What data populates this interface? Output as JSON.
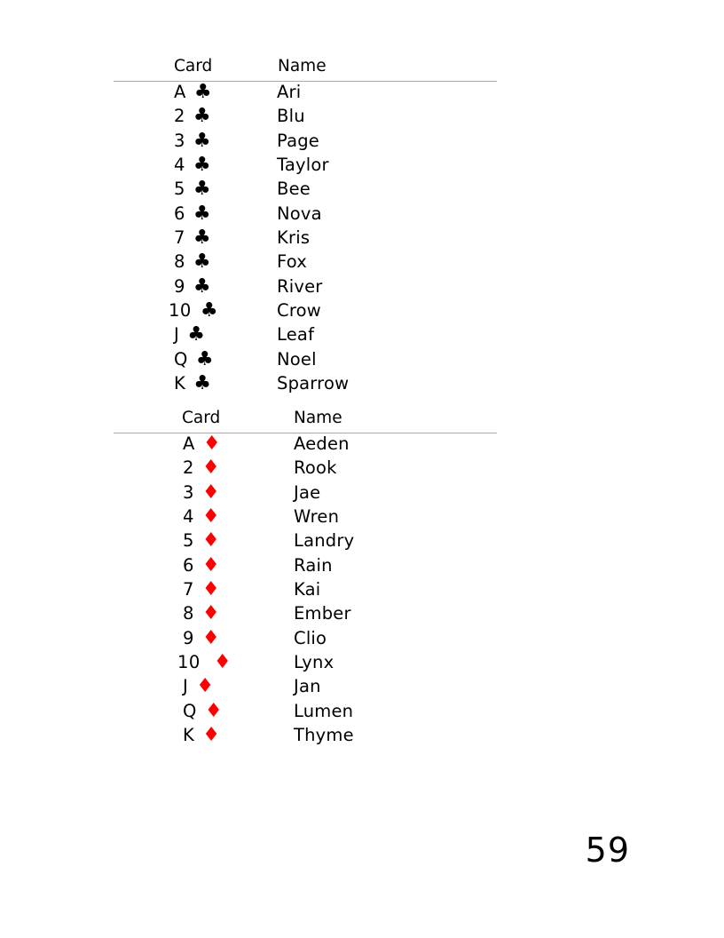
{
  "clubs": {
    "header_card": "Card",
    "header_name": "Name",
    "suit_symbol": "♣",
    "suit_color": "#000000",
    "rows": [
      {
        "rank": "A",
        "name": "Ari"
      },
      {
        "rank": "2",
        "name": "Blu"
      },
      {
        "rank": "3",
        "name": "Page"
      },
      {
        "rank": "4",
        "name": "Taylor"
      },
      {
        "rank": "5",
        "name": "Bee"
      },
      {
        "rank": "6",
        "name": "Nova"
      },
      {
        "rank": "7",
        "name": "Kris"
      },
      {
        "rank": "8",
        "name": "Fox"
      },
      {
        "rank": "9",
        "name": "River"
      },
      {
        "rank": "10",
        "name": "Crow"
      },
      {
        "rank": "J",
        "name": "Leaf"
      },
      {
        "rank": "Q",
        "name": "Noel"
      },
      {
        "rank": "K",
        "name": "Sparrow"
      }
    ]
  },
  "diamonds": {
    "header_card": "Card",
    "header_name": "Name",
    "suit_symbol": "♦",
    "suit_color": "#ff0000",
    "rows": [
      {
        "rank": "A",
        "name": "Aeden"
      },
      {
        "rank": "2",
        "name": "Rook"
      },
      {
        "rank": "3",
        "name": "Jae"
      },
      {
        "rank": "4",
        "name": "Wren"
      },
      {
        "rank": "5",
        "name": "Landry"
      },
      {
        "rank": "6",
        "name": "Rain"
      },
      {
        "rank": "7",
        "name": "Kai"
      },
      {
        "rank": "8",
        "name": "Ember"
      },
      {
        "rank": "9",
        "name": "Clio"
      },
      {
        "rank": "10",
        "name": "Lynx"
      },
      {
        "rank": "J",
        "name": "Jan"
      },
      {
        "rank": "Q",
        "name": "Lumen"
      },
      {
        "rank": "K",
        "name": "Thyme"
      }
    ]
  },
  "page_number": "59"
}
